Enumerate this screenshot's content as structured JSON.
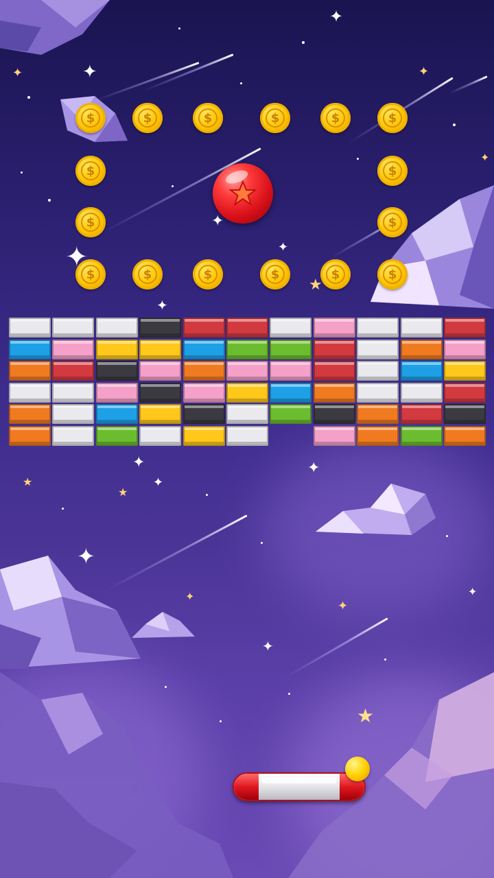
{
  "game": {
    "type": "brick-breaker",
    "background_theme": "starry night sky with shooting stars and low-poly clouds"
  },
  "colors": {
    "white": "#e9e9ee",
    "blue": "#1ea0e6",
    "pink": "#f4a0c8",
    "yellow": "#ffc81a",
    "orange": "#f07a20",
    "red": "#d23a40",
    "green": "#6cbc30",
    "black": "#3a3a40"
  },
  "coin_icon": "dollar-coin-icon",
  "coin_symbol": "$",
  "coins_count": 16,
  "bricks": {
    "rows": [
      [
        "white",
        "white",
        "white",
        "black",
        "red",
        "red",
        "white",
        "pink",
        "white",
        "white",
        "red"
      ],
      [
        "blue",
        "pink",
        "yellow",
        "yellow",
        "blue",
        "green",
        "green",
        "red",
        "white",
        "orange",
        "pink"
      ],
      [
        "orange",
        "red",
        "black",
        "pink",
        "orange",
        "pink",
        "pink",
        "red",
        "white",
        "blue",
        "yellow"
      ],
      [
        "white",
        "white",
        "pink",
        "black",
        "pink",
        "yellow",
        "blue",
        "orange",
        "white",
        "white",
        "red"
      ],
      [
        "orange",
        "white",
        "blue",
        "yellow",
        "black",
        "white",
        "green",
        "black",
        "orange",
        "red",
        "black"
      ],
      [
        "orange",
        "white",
        "green",
        "white",
        "yellow",
        "white",
        null,
        "pink",
        "orange",
        "green",
        "orange"
      ]
    ]
  },
  "ball": {
    "icon": "star-icon",
    "color": "#e01820"
  },
  "paddle": {
    "color": "#e01820"
  },
  "extra_ball": {
    "color": "#ffc400"
  }
}
